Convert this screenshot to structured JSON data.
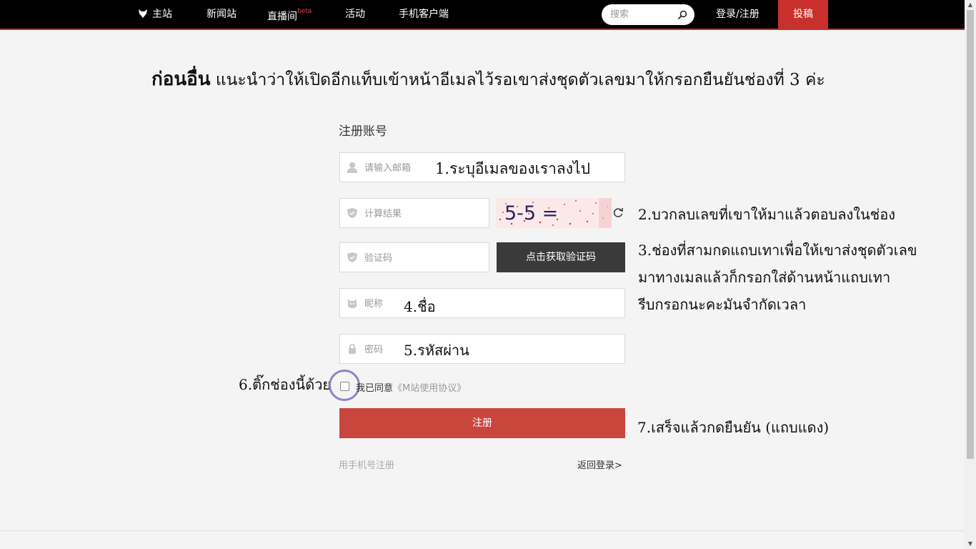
{
  "nav": {
    "home": "主站",
    "news": "新闻站",
    "live": "直播间",
    "live_badge": "beta",
    "events": "活动",
    "mobile": "手机客户端",
    "search_placeholder": "搜索",
    "login": "登录/注册",
    "submit": "投稿"
  },
  "colors": {
    "brand_red": "#c9302c",
    "register_red": "#c9463d",
    "dark_button": "#3a3a3a"
  },
  "annotations": {
    "headline_bold": "ก่อนอื่น",
    "headline_rest": " แนะนำว่าให้เปิดอีกแท็บเข้าหน้าอีเมลไว้รอเขาส่งชุดตัวเลขมาให้กรอกยืนยันช่องที่ 3 ค่ะ",
    "step1": "1.ระบุอีเมลของเราลงไป",
    "step2": "2.บวกลบเลขที่เขาให้มาแล้วตอบลงในช่อง",
    "step3_line1": "3.ช่องที่สามกดแถบเทาเพื่อให้เขาส่งชุดตัวเลข",
    "step3_line2": "มาทางเมลแล้วก็กรอกใส่ด้านหน้าแถบเทา",
    "step3_line3": "รีบกรอกนะคะมันจำกัดเวลา",
    "step4": "4.ชื่อ",
    "step5": "5.รหัสผ่าน",
    "step6": "6.ติ๊กช่องนี้ด้วย",
    "step7": "7.เสร็จแล้วกดยืนยัน (แถบแดง)"
  },
  "form": {
    "title": "注册账号",
    "email_placeholder": "请输入邮箱",
    "calc_placeholder": "计算结果",
    "captcha_text": "5-5 =",
    "code_placeholder": "验证码",
    "get_code_label": "点击获取验证码",
    "nickname_placeholder": "昵称",
    "password_placeholder": "密码",
    "agree_text": "我已同意",
    "agree_link": "《M站使用协议》",
    "register_label": "注册",
    "phone_register": "用手机号注册",
    "back_login": "返回登录>"
  }
}
